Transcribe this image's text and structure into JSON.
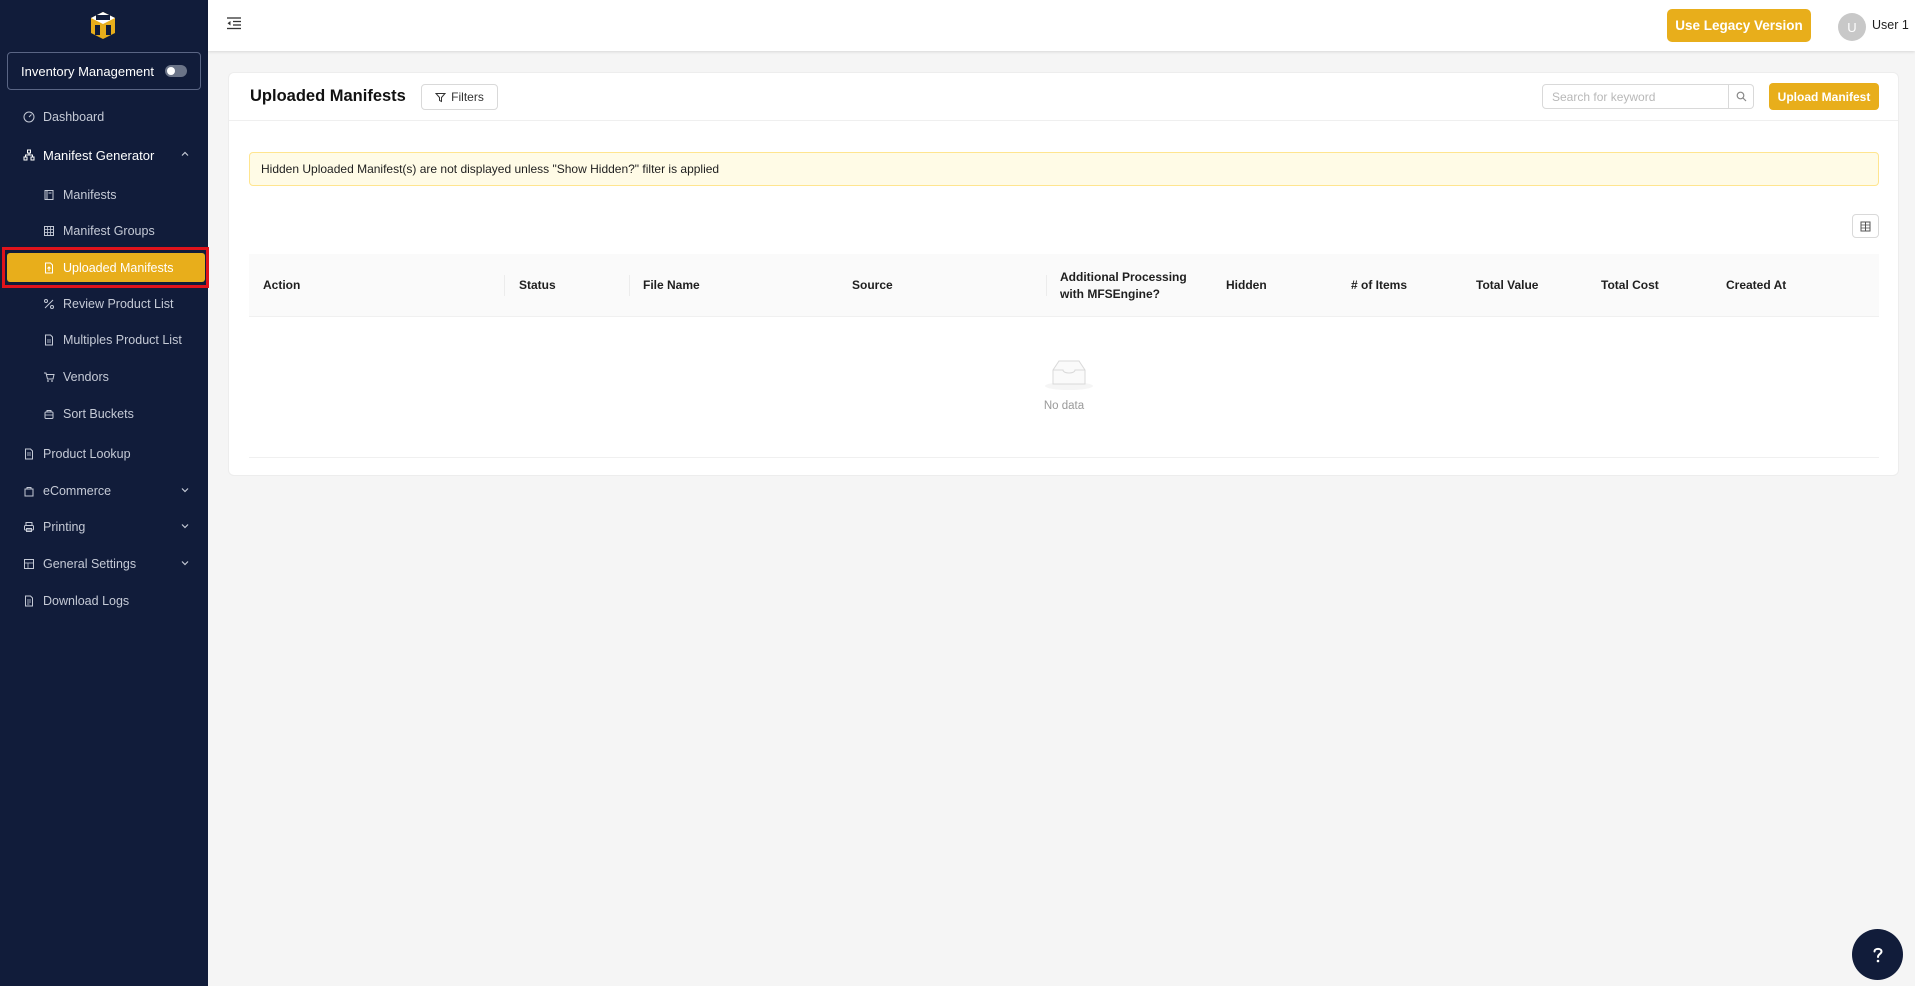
{
  "sidebar": {
    "toggle_label": "Inventory Management",
    "items": [
      {
        "label": "Dashboard",
        "icon": "gauge-icon"
      },
      {
        "label": "Manifest Generator",
        "icon": "sitemap-icon",
        "expanded": true
      },
      {
        "label": "Manifests",
        "icon": "book-icon"
      },
      {
        "label": "Manifest Groups",
        "icon": "grid-icon"
      },
      {
        "label": "Uploaded Manifests",
        "icon": "file-upload-icon",
        "active": true
      },
      {
        "label": "Review Product List",
        "icon": "percent-icon"
      },
      {
        "label": "Multiples Product List",
        "icon": "file-icon"
      },
      {
        "label": "Vendors",
        "icon": "cart-icon"
      },
      {
        "label": "Sort Buckets",
        "icon": "bucket-icon"
      },
      {
        "label": "Product Lookup",
        "icon": "file-search-icon"
      },
      {
        "label": "eCommerce",
        "icon": "bag-icon"
      },
      {
        "label": "Printing",
        "icon": "printer-icon"
      },
      {
        "label": "General Settings",
        "icon": "settings-grid-icon"
      },
      {
        "label": "Download Logs",
        "icon": "file-log-icon"
      }
    ]
  },
  "topbar": {
    "legacy_label": "Use Legacy Version",
    "avatar_initial": "U",
    "username": "User 1"
  },
  "main": {
    "title": "Uploaded Manifests",
    "filters_label": "Filters",
    "search_placeholder": "Search for keyword",
    "upload_label": "Upload Manifest",
    "alert": "Hidden Uploaded Manifest(s) are not displayed unless \"Show Hidden?\" filter is applied",
    "columns": [
      "Action",
      "Status",
      "File Name",
      "Source",
      "Additional Processing with MFSEngine?",
      "Hidden",
      "# of Items",
      "Total Value",
      "Total Cost",
      "Created At"
    ],
    "empty_text": "No data"
  },
  "colors": {
    "sidebar_bg": "#111c3a",
    "accent": "#e8ae1b",
    "highlight_outline": "#e0131b"
  }
}
